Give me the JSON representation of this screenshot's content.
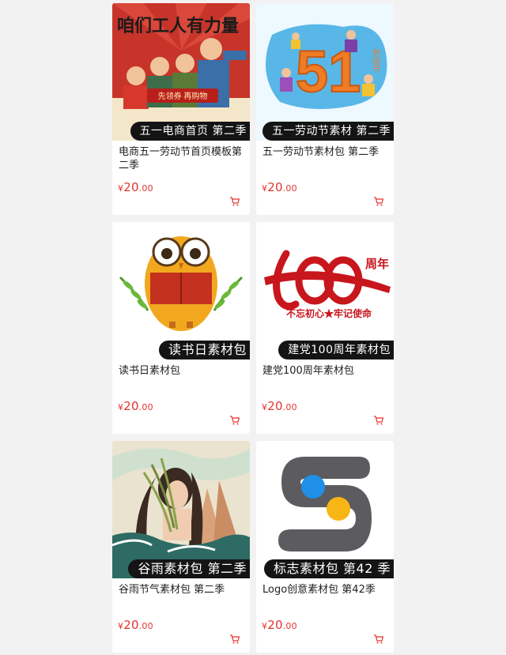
{
  "products": [
    {
      "banner": "五一电商首页 第二季",
      "title": "电商五一劳动节首页模板第二季",
      "currency": "¥",
      "price_int": "20",
      "price_dec": ".00",
      "thumb_icon": "labor-poster-icon",
      "banner_text_art": "咱们工人有力量",
      "sub_text_art": "先领券 再购物"
    },
    {
      "banner": "五一劳动节素材 第二季",
      "title": "五一劳动节素材包 第二季",
      "currency": "¥",
      "price_int": "20",
      "price_dec": ".00",
      "thumb_icon": "51-art-icon",
      "art_text": "51",
      "side_text": "劳动节"
    },
    {
      "banner": "读书日素材包",
      "title": "读书日素材包",
      "currency": "¥",
      "price_int": "20",
      "price_dec": ".00",
      "thumb_icon": "owl-reading-icon"
    },
    {
      "banner": "建党100周年素材包",
      "title": "建党100周年素材包",
      "currency": "¥",
      "price_int": "20",
      "price_dec": ".00",
      "thumb_icon": "centenary-logo-icon",
      "art_year": "周年",
      "art_slogan": "不忘初心★牢记使命"
    },
    {
      "banner": "谷雨素材包 第二季",
      "title": "谷雨节气素材包 第二季",
      "currency": "¥",
      "price_int": "20",
      "price_dec": ".00",
      "thumb_icon": "grain-rain-illustration-icon"
    },
    {
      "banner": "标志素材包 第42 季",
      "title": "Logo创意素材包 第42季",
      "currency": "¥",
      "price_int": "20",
      "price_dec": ".00",
      "thumb_icon": "s-logo-icon"
    }
  ],
  "colors": {
    "price": "#e5322d",
    "banner_bg": "#141414",
    "page_bg": "#f2f2f2"
  }
}
